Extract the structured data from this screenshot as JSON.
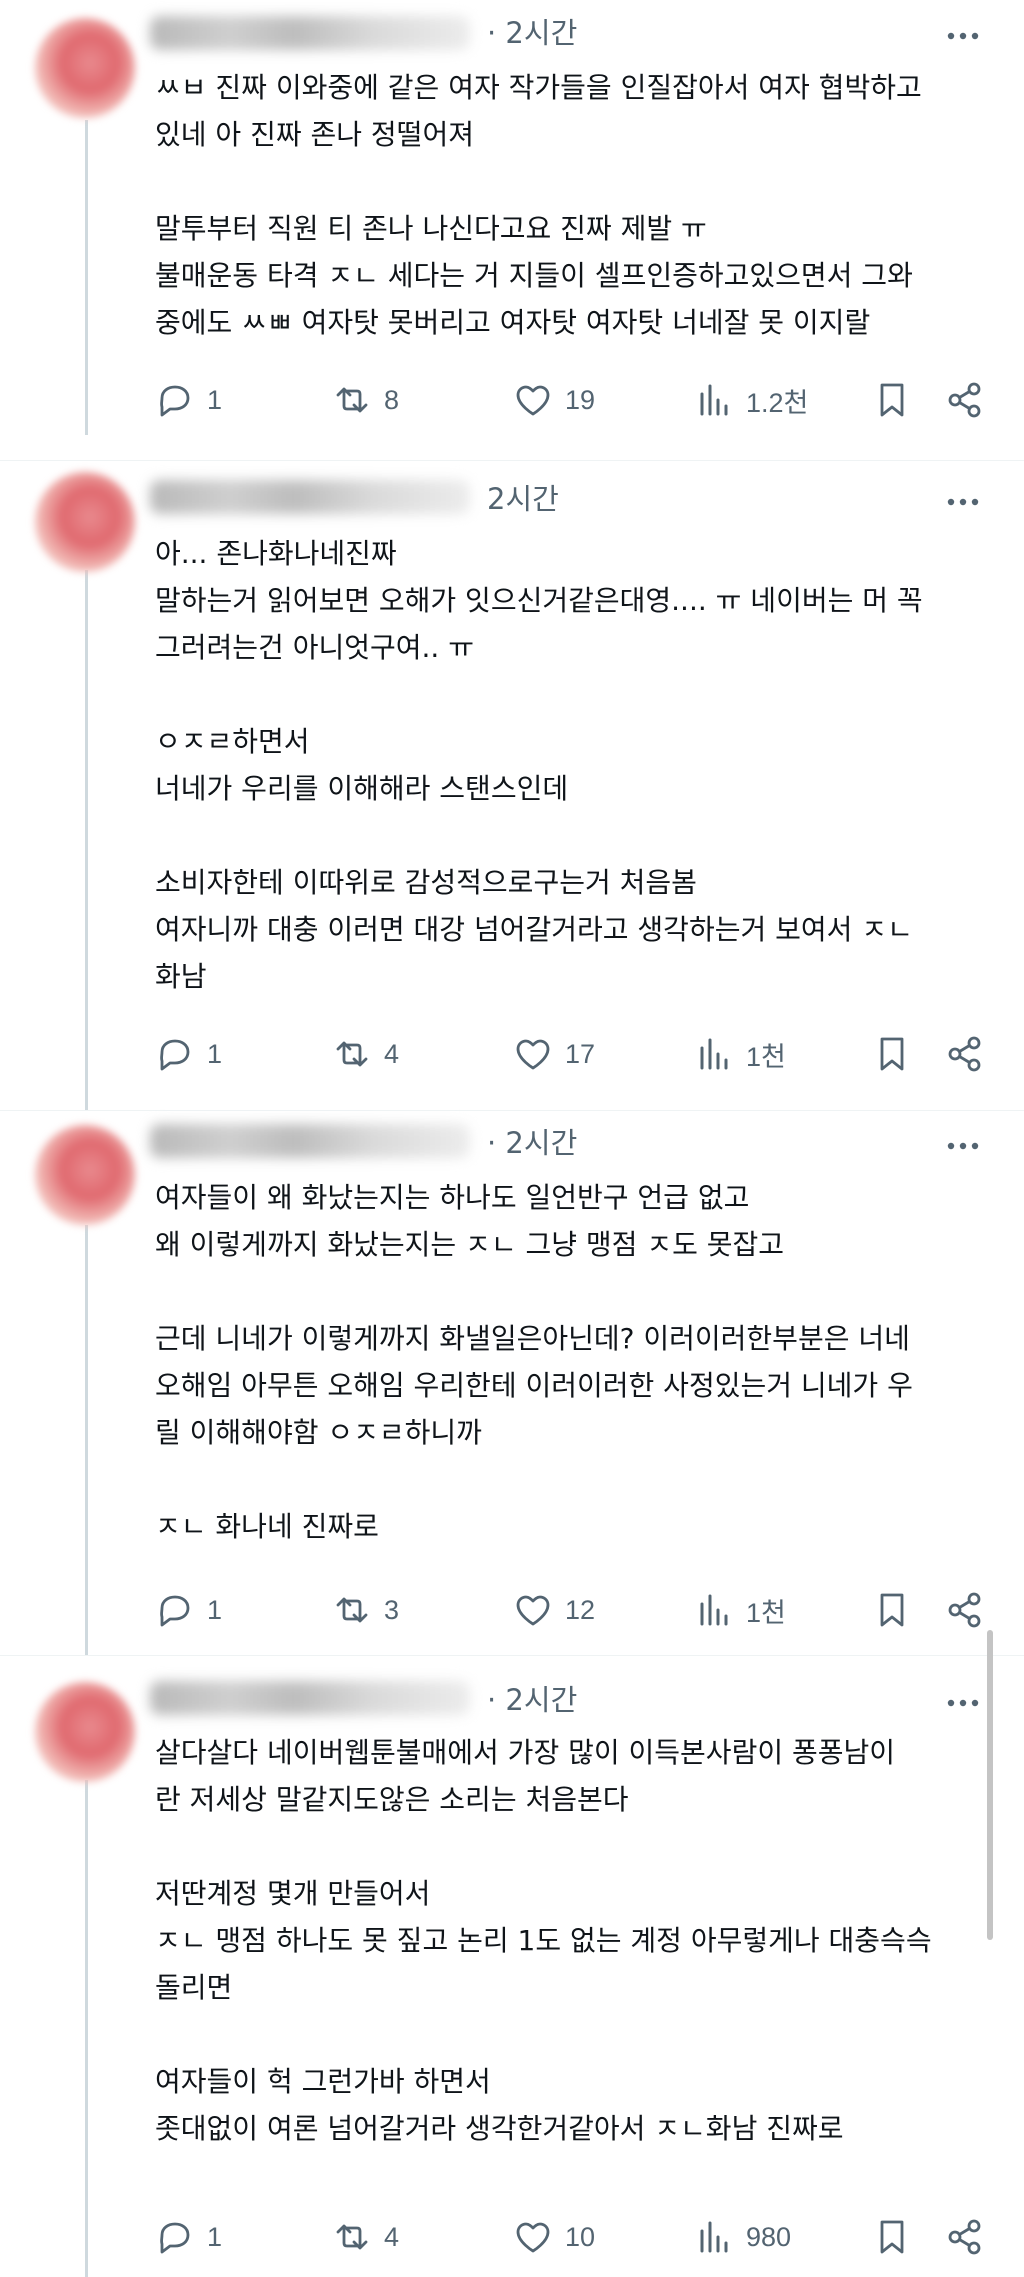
{
  "posts": [
    {
      "time": "· 2시간",
      "paragraphs": [
        [
          "ㅆㅂ 진짜 이와중에 같은 여자 작가들을 인질잡아서 여자 협박하고",
          "있네 아 진짜 존나 정떨어져"
        ],
        [
          "말투부터 직원 티 존나 나신다고요 진짜 제발 ㅠ",
          "불매운동 타격 ㅈㄴ 세다는 거 지들이 셀프인증하고있으면서 그와",
          "중에도 ㅆㅃ 여자탓 못버리고 여자탓 여자탓 너네잘 못 이지랄"
        ]
      ],
      "replies": "1",
      "reposts": "8",
      "likes": "19",
      "views": "1.2천"
    },
    {
      "time": "2시간",
      "paragraphs": [
        [
          "아... 존나화나네진짜",
          "말하는거 읽어보면 오해가 잇으신거같은대영.... ㅠ 네이버는 머 꼭",
          "그러려는건 아니엇구여.. ㅠ"
        ],
        [
          "ㅇㅈㄹ하면서",
          "너네가 우리를 이해해라 스탠스인데"
        ],
        [
          "소비자한테 이따위로 감성적으로구는거 처음봄",
          "여자니까 대충 이러면 대강 넘어갈거라고 생각하는거 보여서 ㅈㄴ",
          "화남"
        ]
      ],
      "replies": "1",
      "reposts": "4",
      "likes": "17",
      "views": "1천"
    },
    {
      "time": "· 2시간",
      "paragraphs": [
        [
          "여자들이 왜 화났는지는 하나도 일언반구 언급 없고",
          "왜 이렇게까지 화났는지는 ㅈㄴ 그냥 맹점 ㅈ도 못잡고"
        ],
        [
          "근데 니네가 이렇게까지 화낼일은아닌데? 이러이러한부분은 너네",
          "오해임 아무튼 오해임 우리한테 이러이러한 사정있는거 니네가 우",
          "릴 이해해야함 ㅇㅈㄹ하니까"
        ],
        [
          "ㅈㄴ 화나네 진짜로"
        ]
      ],
      "replies": "1",
      "reposts": "3",
      "likes": "12",
      "views": "1천"
    },
    {
      "time": "· 2시간",
      "paragraphs": [
        [
          "살다살다 네이버웹툰불매에서 가장 많이 이득본사람이 퐁퐁남이",
          "란 저세상 말같지도않은 소리는 처음본다"
        ],
        [
          "저딴계정 몇개 만들어서",
          "ㅈㄴ 맹점 하나도 못 짚고 논리 1도 없는 계정 아무렇게나 대충슥슥",
          "돌리면"
        ],
        [
          "여자들이 헉 그런가바 하면서",
          "좃대없이 여론 넘어갈거라 생각한거같아서 ㅈㄴ화남 진짜로"
        ]
      ],
      "replies": "1",
      "reposts": "4",
      "likes": "10",
      "views": "980"
    }
  ],
  "icons": {
    "reply": "reply-bubble-icon",
    "repost": "repost-icon",
    "like": "heart-icon",
    "views": "views-bar-chart-icon",
    "bookmark": "bookmark-icon",
    "share": "share-icon",
    "more": "more-dots-icon"
  },
  "colors": {
    "text": "#0f1419",
    "secondary": "#536471",
    "divider": "#eff3f4",
    "thread_line": "#cfd9de"
  }
}
